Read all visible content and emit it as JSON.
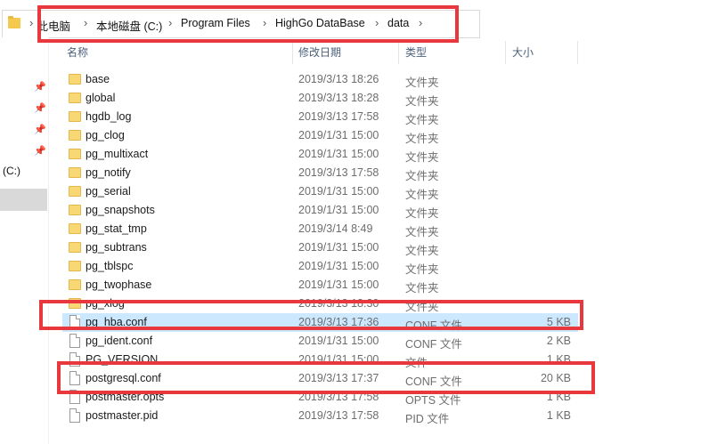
{
  "address": {
    "breadcrumbs": [
      "此电脑",
      "本地磁盘 (C:)",
      "Program Files",
      "HighGo DataBase",
      "data"
    ]
  },
  "sidebar": {
    "drive_label": "(C:)"
  },
  "columns": {
    "name": "名称",
    "date": "修改日期",
    "type": "类型",
    "size": "大小"
  },
  "files": [
    {
      "name": "base",
      "date": "2019/3/13 18:26",
      "type": "文件夹",
      "size": "",
      "kind": "folder"
    },
    {
      "name": "global",
      "date": "2019/3/13 18:28",
      "type": "文件夹",
      "size": "",
      "kind": "folder"
    },
    {
      "name": "hgdb_log",
      "date": "2019/3/13 17:58",
      "type": "文件夹",
      "size": "",
      "kind": "folder"
    },
    {
      "name": "pg_clog",
      "date": "2019/1/31 15:00",
      "type": "文件夹",
      "size": "",
      "kind": "folder"
    },
    {
      "name": "pg_multixact",
      "date": "2019/1/31 15:00",
      "type": "文件夹",
      "size": "",
      "kind": "folder"
    },
    {
      "name": "pg_notify",
      "date": "2019/3/13 17:58",
      "type": "文件夹",
      "size": "",
      "kind": "folder"
    },
    {
      "name": "pg_serial",
      "date": "2019/1/31 15:00",
      "type": "文件夹",
      "size": "",
      "kind": "folder"
    },
    {
      "name": "pg_snapshots",
      "date": "2019/1/31 15:00",
      "type": "文件夹",
      "size": "",
      "kind": "folder"
    },
    {
      "name": "pg_stat_tmp",
      "date": "2019/3/14 8:49",
      "type": "文件夹",
      "size": "",
      "kind": "folder"
    },
    {
      "name": "pg_subtrans",
      "date": "2019/1/31 15:00",
      "type": "文件夹",
      "size": "",
      "kind": "folder"
    },
    {
      "name": "pg_tblspc",
      "date": "2019/1/31 15:00",
      "type": "文件夹",
      "size": "",
      "kind": "folder"
    },
    {
      "name": "pg_twophase",
      "date": "2019/1/31 15:00",
      "type": "文件夹",
      "size": "",
      "kind": "folder"
    },
    {
      "name": "pg_xlog",
      "date": "2019/3/13 18:30",
      "type": "文件夹",
      "size": "",
      "kind": "folder"
    },
    {
      "name": "pg_hba.conf",
      "date": "2019/3/13 17:36",
      "type": "CONF 文件",
      "size": "5 KB",
      "kind": "file",
      "selected": true
    },
    {
      "name": "pg_ident.conf",
      "date": "2019/1/31 15:00",
      "type": "CONF 文件",
      "size": "2 KB",
      "kind": "file"
    },
    {
      "name": "PG_VERSION",
      "date": "2019/1/31 15:00",
      "type": "文件",
      "size": "1 KB",
      "kind": "file"
    },
    {
      "name": "postgresql.conf",
      "date": "2019/3/13 17:37",
      "type": "CONF 文件",
      "size": "20 KB",
      "kind": "file"
    },
    {
      "name": "postmaster.opts",
      "date": "2019/3/13 17:58",
      "type": "OPTS 文件",
      "size": "1 KB",
      "kind": "file"
    },
    {
      "name": "postmaster.pid",
      "date": "2019/3/13 17:58",
      "type": "PID 文件",
      "size": "1 KB",
      "kind": "file"
    }
  ],
  "colors": {
    "annotation_red": "#e8373d",
    "selection_blue": "#cce8ff",
    "folder_yellow": "#f8d775"
  }
}
